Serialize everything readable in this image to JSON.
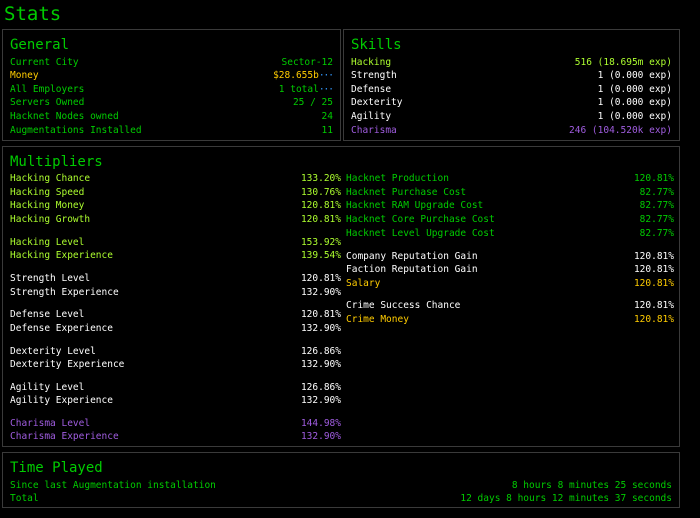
{
  "page_title": "Stats",
  "general": {
    "title": "General",
    "rows": [
      {
        "label": "Current City",
        "value": "Sector-12",
        "color": "g"
      },
      {
        "label": "Money",
        "value": "$28.655b",
        "color": "y",
        "dots": true
      },
      {
        "label": "All Employers",
        "value": "1 total",
        "color": "g",
        "dots": true
      },
      {
        "label": "Servers Owned",
        "value": "25 / 25",
        "color": "g"
      },
      {
        "label": "Hacknet Nodes owned",
        "value": "24",
        "color": "g"
      },
      {
        "label": "Augmentations Installed",
        "value": "11",
        "color": "g"
      }
    ]
  },
  "skills": {
    "title": "Skills",
    "rows": [
      {
        "label": "Hacking",
        "value": "516 (18.695m exp)",
        "color": "lg"
      },
      {
        "label": "Strength",
        "value": "1 (0.000 exp)",
        "color": "w"
      },
      {
        "label": "Defense",
        "value": "1 (0.000 exp)",
        "color": "w"
      },
      {
        "label": "Dexterity",
        "value": "1 (0.000 exp)",
        "color": "w"
      },
      {
        "label": "Agility",
        "value": "1 (0.000 exp)",
        "color": "w"
      },
      {
        "label": "Charisma",
        "value": "246 (104.520k exp)",
        "color": "p"
      }
    ]
  },
  "multipliers": {
    "title": "Multipliers",
    "left": [
      {
        "label": "Hacking Chance",
        "value": "133.20%",
        "color": "lg"
      },
      {
        "label": "Hacking Speed",
        "value": "130.76%",
        "color": "lg"
      },
      {
        "label": "Hacking Money",
        "value": "120.81%",
        "color": "lg"
      },
      {
        "label": "Hacking Growth",
        "value": "120.81%",
        "color": "lg"
      },
      {
        "label": "Hacking Level",
        "value": "153.92%",
        "color": "lg"
      },
      {
        "label": "Hacking Experience",
        "value": "139.54%",
        "color": "lg"
      },
      {
        "label": "Strength Level",
        "value": "120.81%",
        "color": "w"
      },
      {
        "label": "Strength Experience",
        "value": "132.90%",
        "color": "w"
      },
      {
        "label": "Defense Level",
        "value": "120.81%",
        "color": "w"
      },
      {
        "label": "Defense Experience",
        "value": "132.90%",
        "color": "w"
      },
      {
        "label": "Dexterity Level",
        "value": "126.86%",
        "color": "w"
      },
      {
        "label": "Dexterity Experience",
        "value": "132.90%",
        "color": "w"
      },
      {
        "label": "Agility Level",
        "value": "126.86%",
        "color": "w"
      },
      {
        "label": "Agility Experience",
        "value": "132.90%",
        "color": "w"
      },
      {
        "label": "Charisma Level",
        "value": "144.98%",
        "color": "p"
      },
      {
        "label": "Charisma Experience",
        "value": "132.90%",
        "color": "p"
      }
    ],
    "right": [
      {
        "label": "Hacknet Production",
        "value": "120.81%",
        "color": "g"
      },
      {
        "label": "Hacknet Purchase Cost",
        "value": "82.77%",
        "color": "g"
      },
      {
        "label": "Hacknet RAM Upgrade Cost",
        "value": "82.77%",
        "color": "g"
      },
      {
        "label": "Hacknet Core Purchase Cost",
        "value": "82.77%",
        "color": "g"
      },
      {
        "label": "Hacknet Level Upgrade Cost",
        "value": "82.77%",
        "color": "g"
      },
      {
        "label": "Company Reputation Gain",
        "value": "120.81%",
        "color": "w"
      },
      {
        "label": "Faction Reputation Gain",
        "value": "120.81%",
        "color": "w"
      },
      {
        "label": "Salary",
        "value": "120.81%",
        "color": "y"
      },
      {
        "label": "Crime Success Chance",
        "value": "120.81%",
        "color": "w"
      },
      {
        "label": "Crime Money",
        "value": "120.81%",
        "color": "y"
      }
    ]
  },
  "time_played": {
    "title": "Time Played",
    "rows": [
      {
        "label": "Since last Augmentation installation",
        "value": "8 hours 8 minutes 25 seconds",
        "color": "g"
      },
      {
        "label": "Total",
        "value": "12 days 8 hours 12 minutes 37 seconds",
        "color": "g"
      }
    ]
  }
}
